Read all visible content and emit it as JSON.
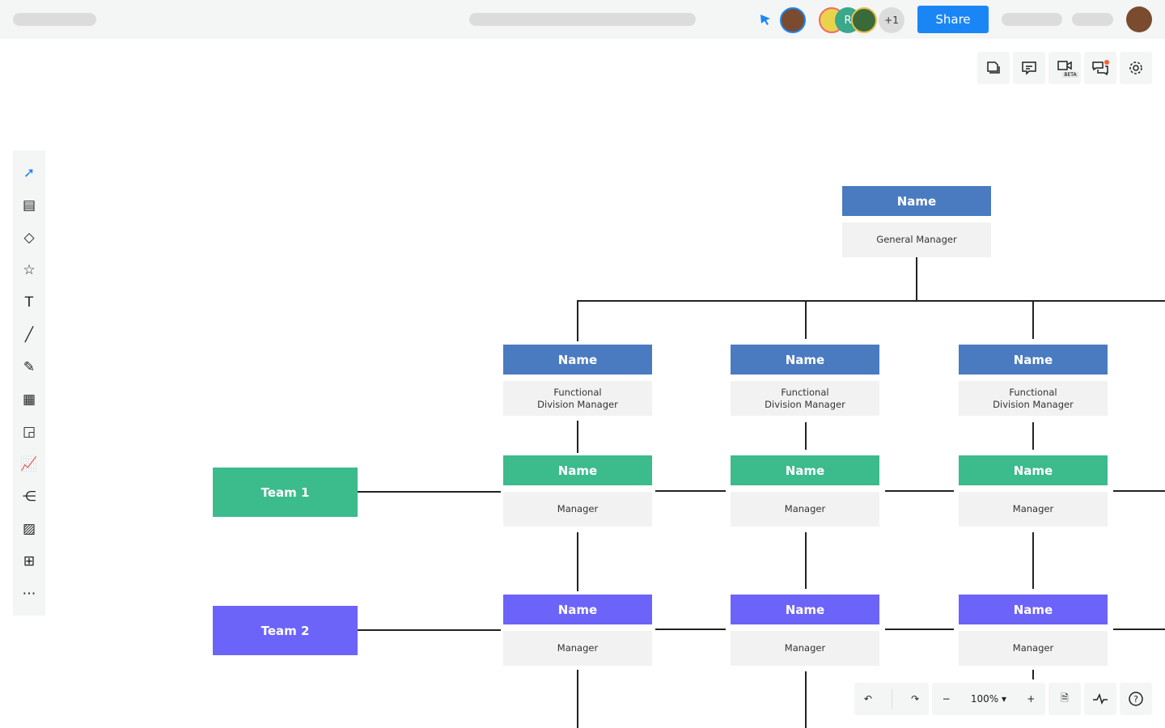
{
  "topbar": {
    "collab_count": "+1",
    "collab_initial": "R",
    "share_label": "Share"
  },
  "right_toolbar": {
    "beta_label": "BETA",
    "icons": [
      "pages-icon",
      "comments-icon",
      "video-icon",
      "chat-icon",
      "settings-icon"
    ]
  },
  "left_toolbar": {
    "icons": [
      "select-icon",
      "document-icon",
      "shapes-icon",
      "star-icon",
      "text-icon",
      "line-icon",
      "pen-icon",
      "table-icon",
      "sticky-note-icon",
      "chart-icon",
      "mindmap-icon",
      "image-icon",
      "comment-add-icon",
      "more-icon"
    ]
  },
  "colors": {
    "blue": "#4a7bc0",
    "green": "#3cbb8d",
    "purple": "#6c63f8",
    "accent": "#1a86f6"
  },
  "chart": {
    "gm": {
      "name": "Name",
      "role": "General Manager"
    },
    "columns": [
      {
        "division": {
          "name": "Name",
          "role": "Functional\nDivision Manager"
        },
        "team1": {
          "name": "Name",
          "role": "Manager"
        },
        "team2": {
          "name": "Name",
          "role": "Manager"
        }
      },
      {
        "division": {
          "name": "Name",
          "role": "Functional\nDivision Manager"
        },
        "team1": {
          "name": "Name",
          "role": "Manager"
        },
        "team2": {
          "name": "Name",
          "role": "Manager"
        }
      },
      {
        "division": {
          "name": "Name",
          "role": "Functional\nDivision Manager"
        },
        "team1": {
          "name": "Name",
          "role": "Manager"
        },
        "team2": {
          "name": "Name",
          "role": "Manager"
        }
      }
    ],
    "teams": [
      "Team 1",
      "Team 2"
    ]
  },
  "bottom": {
    "zoom": "100%"
  }
}
